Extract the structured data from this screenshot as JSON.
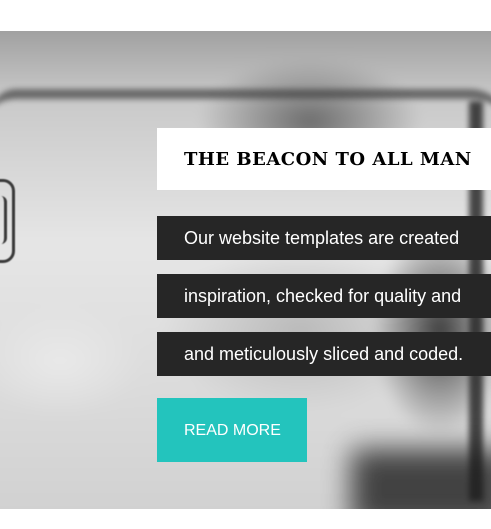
{
  "hero": {
    "title": "THE BEACON TO ALL MAN",
    "description_lines": [
      "Our website templates are created",
      "inspiration, checked for quality and",
      "and meticulously sliced and coded."
    ],
    "cta_label": "READ MORE"
  },
  "colors": {
    "accent": "#23c4bd",
    "text_panel": "#262626",
    "title_panel": "#ffffff"
  }
}
